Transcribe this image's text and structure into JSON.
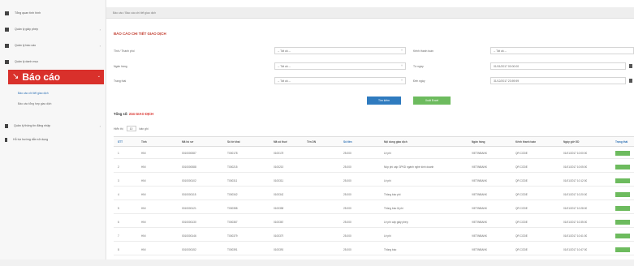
{
  "sidebar": {
    "items": [
      {
        "icon": "dashboard-icon",
        "label": "Tổng quan tình hình"
      },
      {
        "icon": "list-icon",
        "label": "Quản lý giấy phép"
      },
      {
        "icon": "file-icon",
        "label": "Quản lý báo cáo"
      },
      {
        "icon": "folder-icon",
        "label": "Quản lý danh mục"
      }
    ],
    "active": {
      "icon": "chart-line-icon",
      "label": "Báo cáo"
    },
    "sub_items": [
      {
        "label": "Báo cáo chi tiết giao dịch",
        "active": true
      },
      {
        "label": "Báo cáo tổng hợp giao dịch",
        "active": false
      }
    ],
    "bottom_items": [
      {
        "icon": "user-icon",
        "label": "Quản lý thông tin đăng nhập"
      },
      {
        "icon": "info-icon",
        "label": "Hỗ trợ hướng dẫn sử dụng"
      }
    ]
  },
  "breadcrumb": "Báo cáo  /  Báo cáo chi tiết giao dịch",
  "page_title": "BÁO CÁO CHI TIẾT GIAO DỊCH",
  "filters": {
    "left": [
      {
        "label": "Tỉnh / Thành phố",
        "value": "-- Tất cả --"
      },
      {
        "label": "Ngân hàng",
        "value": "-- Tất cả --"
      },
      {
        "label": "Trạng thái",
        "value": "-- Tất cả --"
      }
    ],
    "right": [
      {
        "label": "Kênh thanh toán",
        "value": "-- Tất cả --"
      },
      {
        "label": "Từ ngày",
        "value": "01/01/2017 00:00:00"
      },
      {
        "label": "Đến ngày",
        "value": "31/12/2017 23:59:59"
      }
    ]
  },
  "buttons": {
    "search": "Tìm kiếm",
    "export": "Xuất Excel"
  },
  "results": {
    "label": "Tổng số:",
    "count": "234 GIAO DỊCH"
  },
  "page_size": {
    "prefix": "Hiển thị",
    "value": "10",
    "suffix": "bản ghi"
  },
  "table": {
    "columns": [
      "STT",
      "Tỉnh",
      "Mã hồ sơ",
      "Số tờ khai",
      "Mã số thuế",
      "Tên DN",
      "Số tiền",
      "Nội dung giao dịch",
      "Ngân hàng",
      "Kênh thanh toán",
      "Ngày giờ GD",
      "Trạng thái"
    ],
    "rows": [
      [
        "1",
        "HNI",
        "0010000087",
        "T000178",
        "0100178",
        "",
        "25.000",
        "Lệ phí",
        "VIETINBANK",
        "QR CODE",
        "01/01/2017 10:00:00"
      ],
      [
        "2",
        "HNI",
        "0010000088",
        "T000215",
        "0100215",
        "",
        "25.000",
        "Nộp phí cấp GPKD ngành nghề kinh doanh",
        "VIETINBANK",
        "QR CODE",
        "01/01/2017 10:05:00"
      ],
      [
        "3",
        "HNI",
        "0010000102",
        "T000311",
        "0100311",
        "",
        "25.000",
        "Lệ phí",
        "VIETINBANK",
        "QR CODE",
        "01/01/2017 10:12:00"
      ],
      [
        "4",
        "HNI",
        "0010000115",
        "T000342",
        "0100342",
        "",
        "25.000",
        "Thông báo phí",
        "VIETINBANK",
        "QR CODE",
        "01/01/2017 10:20:00"
      ],
      [
        "5",
        "HNI",
        "0010000121",
        "T000358",
        "0100358",
        "",
        "25.000",
        "Thông báo lệ phí",
        "VIETINBANK",
        "QR CODE",
        "01/01/2017 10:28:00"
      ],
      [
        "6",
        "HNI",
        "0010000130",
        "T000367",
        "0100367",
        "",
        "25.000",
        "Lệ phí cấp giấy phép",
        "VIETINBANK",
        "QR CODE",
        "01/01/2017 10:35:00"
      ],
      [
        "7",
        "HNI",
        "0010000146",
        "T000379",
        "0100379",
        "",
        "25.000",
        "Lệ phí",
        "VIETINBANK",
        "QR CODE",
        "01/01/2017 10:41:00"
      ],
      [
        "8",
        "HNI",
        "0010000152",
        "T000391",
        "0100391",
        "",
        "25.000",
        "Thông báo",
        "VIETINBANK",
        "QR CODE",
        "01/01/2017 10:47:00"
      ]
    ]
  },
  "colors": {
    "accent": "#d9302b",
    "primary": "#2f7bbf",
    "success": "#6dbb5e"
  }
}
